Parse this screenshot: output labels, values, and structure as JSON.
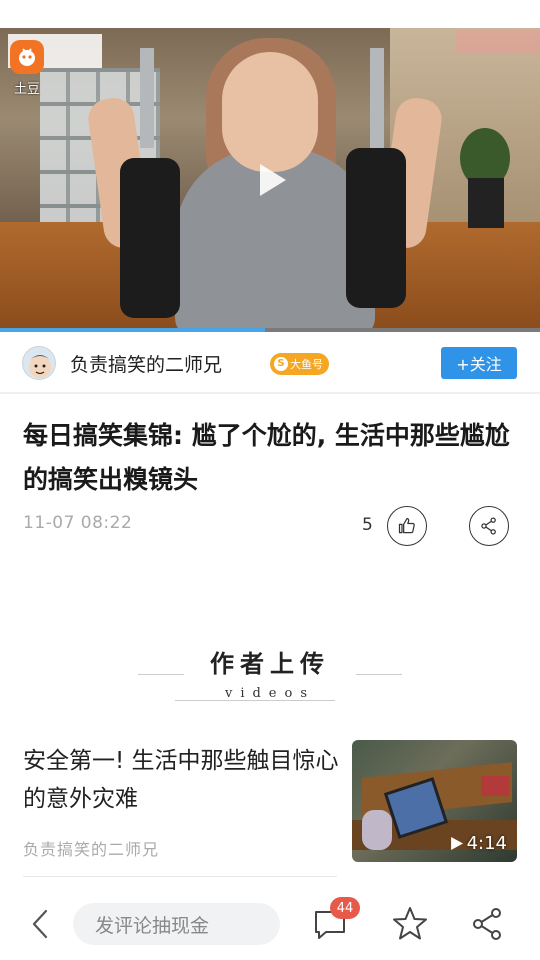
{
  "video": {
    "watermark_label": "土豆",
    "progress_fraction": 0.49,
    "progress_color": "#49a4e8"
  },
  "author": {
    "name": "负责搞笑的二师兄",
    "badge_label": "大鱼号",
    "follow_label": "+关注"
  },
  "article": {
    "title": "每日搞笑集锦: 尴了个尬的, 生活中那些尴尬的搞笑出糗镜头",
    "date": "11-07 08:22",
    "like_count": "5"
  },
  "section": {
    "title": "作者上传",
    "subtitle": "videos"
  },
  "related": [
    {
      "title": "安全第一! 生活中那些触目惊心的意外灾难",
      "author": "负责搞笑的二师兄",
      "duration": "4:14"
    }
  ],
  "bottom_bar": {
    "comment_placeholder": "发评论抽现金",
    "comment_count": "44"
  },
  "colors": {
    "accent": "#2f94e8",
    "badge": "#f5a623",
    "notification": "#e65a4a",
    "brand_orange": "#f27323"
  },
  "icons": [
    "play-icon",
    "tudou-logo-icon",
    "thumb-up-icon",
    "share-icon",
    "back-icon",
    "comment-icon",
    "star-icon"
  ]
}
